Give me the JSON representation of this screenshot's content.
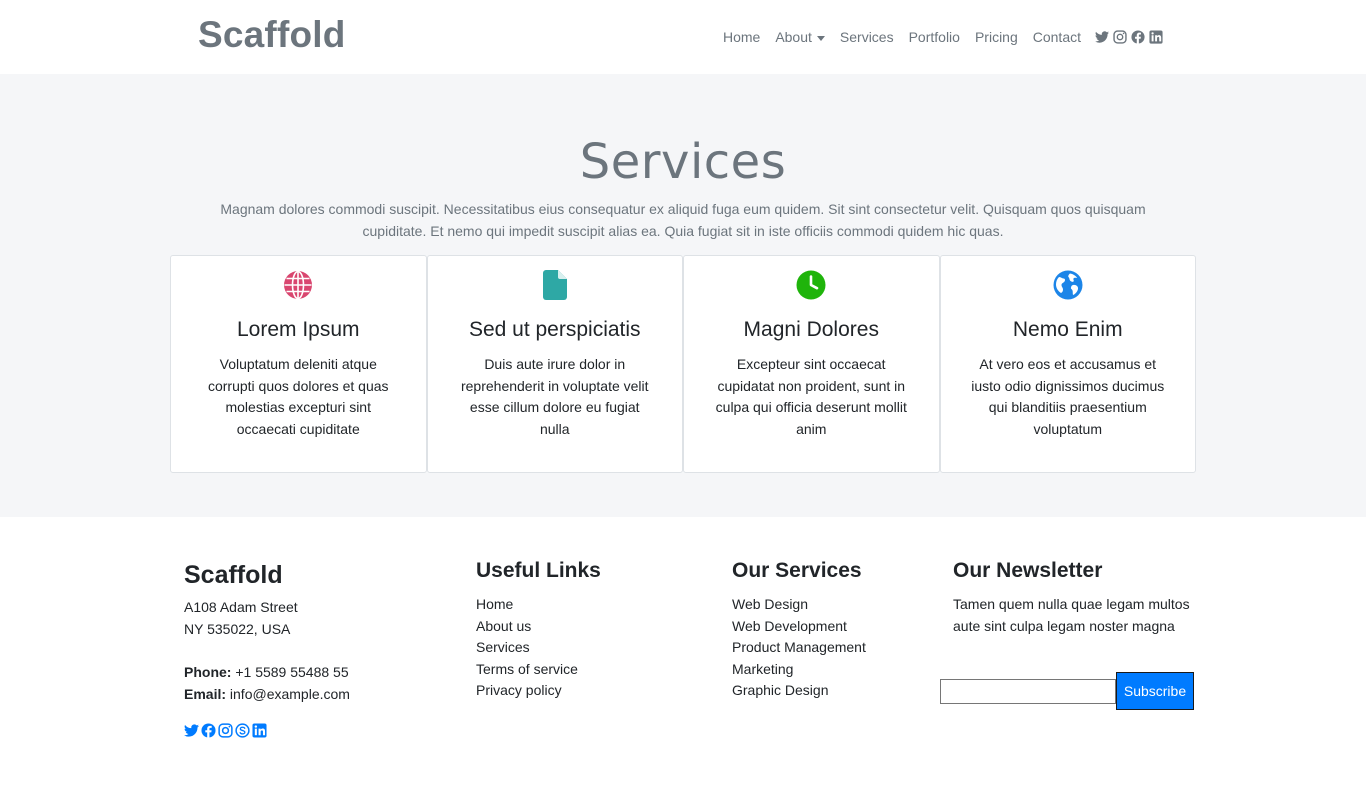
{
  "brand": "Scaffold",
  "nav": {
    "items": [
      "Home",
      "About",
      "Services",
      "Portfolio",
      "Pricing",
      "Contact"
    ],
    "social_icons": [
      "twitter-icon",
      "instagram-icon",
      "facebook-icon",
      "linkedin-icon"
    ]
  },
  "services": {
    "title": "Services",
    "description": "Magnam dolores commodi suscipit. Necessitatibus eius consequatur ex aliquid fuga eum quidem. Sit sint consectetur velit. Quisquam quos quisquam cupiditate. Et nemo qui impedit suscipit alias ea. Quia fugiat sit in iste officiis commodi quidem hic quas.",
    "cards": [
      {
        "icon": "globe-icon",
        "color": "#d9466f",
        "title": "Lorem Ipsum",
        "text": "Voluptatum deleniti atque corrupti quos dolores et quas molestias excepturi sint occaecati cupiditate"
      },
      {
        "icon": "file-icon",
        "color": "#2ea8a5",
        "title": "Sed ut perspiciatis",
        "text": "Duis aute irure dolor in reprehenderit in voluptate velit esse cillum dolore eu fugiat nulla"
      },
      {
        "icon": "clock-icon",
        "color": "#1fb40b",
        "title": "Magni Dolores",
        "text": "Excepteur sint occaecat cupidatat non proident, sunt in culpa qui officia deserunt mollit anim"
      },
      {
        "icon": "earth-icon",
        "color": "#1c85e8",
        "title": "Nemo Enim",
        "text": "At vero eos et accusamus et iusto odio dignissimos ducimus qui blanditiis praesentium voluptatum"
      }
    ]
  },
  "footer": {
    "brand": "Scaffold",
    "address_line1": "A108 Adam Street",
    "address_line2": "NY 535022, USA",
    "phone_label": "Phone:",
    "phone": "+1 5589 55488 55",
    "email_label": "Email:",
    "email": "info@example.com",
    "social_icons": [
      "twitter-icon",
      "facebook-icon",
      "instagram-icon",
      "skype-icon",
      "linkedin-icon"
    ],
    "useful_links": {
      "title": "Useful Links",
      "items": [
        "Home",
        "About us",
        "Services",
        "Terms of service",
        "Privacy policy"
      ]
    },
    "our_services": {
      "title": "Our Services",
      "items": [
        "Web Design",
        "Web Development",
        "Product Management",
        "Marketing",
        "Graphic Design"
      ]
    },
    "newsletter": {
      "title": "Our Newsletter",
      "text": "Tamen quem nulla quae legam multos aute sint culpa legam noster magna",
      "input_value": "",
      "button": "Subscribe"
    }
  },
  "colors": {
    "accent": "#007bff",
    "muted_text": "#6c757d",
    "section_bg": "#f5f6f8"
  }
}
